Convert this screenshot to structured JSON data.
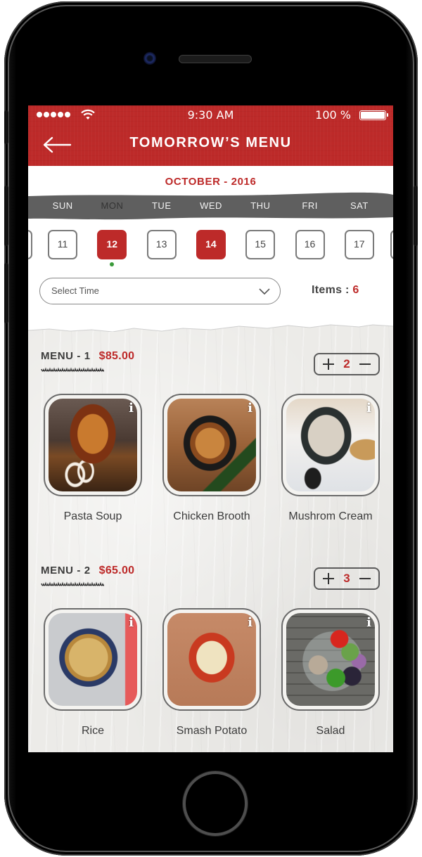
{
  "status_bar": {
    "signal_dots": 5,
    "time": "9:30 AM",
    "battery_percent": "100 %",
    "icons": [
      "signal-dots-icon",
      "wifi-icon",
      "battery-icon"
    ]
  },
  "header": {
    "title": "TOMORROW’S MENU",
    "back_icon": "arrow-left-icon",
    "accent_color": "#bd2a29"
  },
  "calendar": {
    "month_label": "OCTOBER - 2016",
    "weekdays": [
      {
        "label": "SUN",
        "selected": false
      },
      {
        "label": "MON",
        "selected": true
      },
      {
        "label": "TUE",
        "selected": false
      },
      {
        "label": "WED",
        "selected": false
      },
      {
        "label": "THU",
        "selected": false
      },
      {
        "label": "FRI",
        "selected": false
      },
      {
        "label": "SAT",
        "selected": false
      }
    ],
    "dates": [
      {
        "day": "11",
        "active": false,
        "dot": false
      },
      {
        "day": "12",
        "active": true,
        "dot": true
      },
      {
        "day": "13",
        "active": false,
        "dot": false
      },
      {
        "day": "14",
        "active": true,
        "dot": false
      },
      {
        "day": "15",
        "active": false,
        "dot": false
      },
      {
        "day": "16",
        "active": false,
        "dot": false
      },
      {
        "day": "17",
        "active": false,
        "dot": false
      }
    ],
    "dot_color": "#3a9a3a"
  },
  "filters": {
    "time_select": {
      "placeholder": "Select Time",
      "icon": "chevron-down-icon"
    },
    "items_label": "Items :",
    "items_count": "6"
  },
  "menus": [
    {
      "name": "MENU - 1",
      "price": "$85.00",
      "quantity": "2",
      "dishes": [
        {
          "name": "Pasta Soup",
          "info_icon": "i"
        },
        {
          "name": "Chicken Brooth",
          "info_icon": "i"
        },
        {
          "name": "Mushrom Cream",
          "info_icon": "i"
        }
      ]
    },
    {
      "name": "MENU - 2",
      "price": "$65.00",
      "quantity": "3",
      "dishes": [
        {
          "name": "Rice",
          "info_icon": "i"
        },
        {
          "name": "Smash Potato",
          "info_icon": "i"
        },
        {
          "name": "Salad",
          "info_icon": "i"
        }
      ]
    }
  ]
}
